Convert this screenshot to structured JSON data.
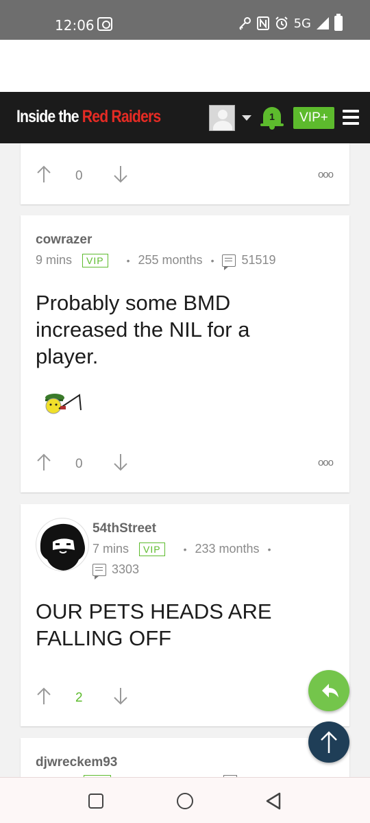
{
  "status_bar": {
    "time": "12:06",
    "network": "5G"
  },
  "header": {
    "logo_part1": "Inside the ",
    "logo_part2": "Red Raiders",
    "notification_count": "1",
    "vip_label": "VIP+"
  },
  "posts": [
    {
      "upvotes": "0",
      "more": "ooo"
    },
    {
      "username": "cowrazer",
      "time": "9 mins",
      "badge": "VIP",
      "tenure": "255 months",
      "post_count": "51519",
      "body_line1": "Probably some BMD",
      "body_line2": "increased the NIL for a",
      "body_line3": "player.",
      "upvotes": "0",
      "more": "ooo"
    },
    {
      "username": "54thStreet",
      "time": "7 mins",
      "badge": "VIP",
      "tenure": "233 months",
      "post_count": "3303",
      "body_line1": "OUR PETS HEADS ARE",
      "body_line2": "FALLING OFF",
      "upvotes": "2"
    },
    {
      "username": "djwreckem93"
    }
  ],
  "colors": {
    "header_bg": "#1b1b1b",
    "logo_red": "#e52b24",
    "accent_green": "#5dbb2d",
    "scroll_top_bg": "#1f3e57"
  }
}
